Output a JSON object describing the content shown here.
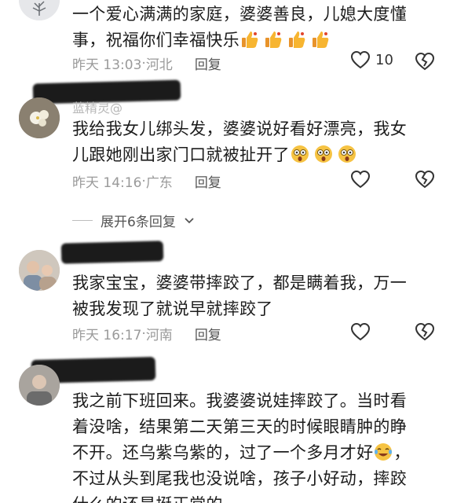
{
  "comments": [
    {
      "text_lines": [
        "一个爱心满满的家庭，婆婆善良，儿媳大度懂",
        "事，祝福你们幸福快乐"
      ],
      "emojis": [
        "thumbs-up",
        "thumbs-up",
        "thumbs-up",
        "thumbs-up"
      ],
      "time": "昨天 13:03",
      "location": "河北",
      "reply_label": "回复",
      "likes": "10"
    },
    {
      "username": "蓝精灵@",
      "text_lines": [
        "我给我女儿绑头发，婆婆说好看好漂亮，我女",
        "儿跟她刚出家门口就被扯开了"
      ],
      "emojis": [
        "shocked-face",
        "shocked-face",
        "shocked-face"
      ],
      "time": "昨天 14:16",
      "location": "广东",
      "reply_label": "回复",
      "expand_label": "展开6条回复"
    },
    {
      "text_lines": [
        "我家宝宝，婆婆带摔跤了，都是瞒着我，万一",
        "被我发现了就说早就摔跤了"
      ],
      "time": "昨天 16:17",
      "location": "河南",
      "reply_label": "回复"
    },
    {
      "text_lines": [
        "我之前下班回来。我婆婆说娃摔跤了。当时看",
        "着没啥，结果第二天第三天的时候眼睛肿的睁",
        "不开。还乌紫乌紫的，过了一个多月才好",
        "，",
        "不过从头到尾我也没说啥，孩子小好动，摔跤",
        "什么的还是挺正常的。"
      ],
      "emojis": [
        "laughing-tears-face"
      ]
    }
  ],
  "colors": {
    "text": "#1c1c1c",
    "meta": "#9a9a9a",
    "redaction": "#1b1b1b"
  }
}
